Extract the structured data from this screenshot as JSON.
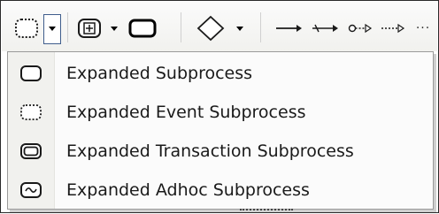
{
  "toolbar": {
    "items": [
      {
        "name": "expanded-subprocess-dashed-icon"
      },
      {
        "name": "dropdown-arrow"
      },
      {
        "name": "collapsed-subprocess-icon"
      },
      {
        "name": "dropdown-arrow"
      },
      {
        "name": "rounded-rectangle-icon"
      },
      {
        "name": "diamond-gateway-icon"
      },
      {
        "name": "dropdown-arrow"
      },
      {
        "name": "sequence-flow-icon"
      },
      {
        "name": "default-flow-icon"
      },
      {
        "name": "message-flow-icon"
      },
      {
        "name": "association-icon"
      },
      {
        "name": "more-icon"
      }
    ],
    "more_glyph": "···"
  },
  "menu": {
    "items": [
      {
        "label": "Expanded Subprocess",
        "icon": "rounded-rect-solid-icon"
      },
      {
        "label": "Expanded Event Subprocess",
        "icon": "rounded-rect-dotted-icon"
      },
      {
        "label": "Expanded Transaction Subprocess",
        "icon": "rounded-rect-double-icon"
      },
      {
        "label": "Expanded Adhoc Subprocess",
        "icon": "rounded-rect-tilde-icon"
      }
    ]
  },
  "colors": {
    "accent": "#3f5d8c",
    "icon_stroke": "#1a1a1a",
    "menu_bg": "#fbfbfb",
    "gutter_bg": "#f1f1ee"
  }
}
